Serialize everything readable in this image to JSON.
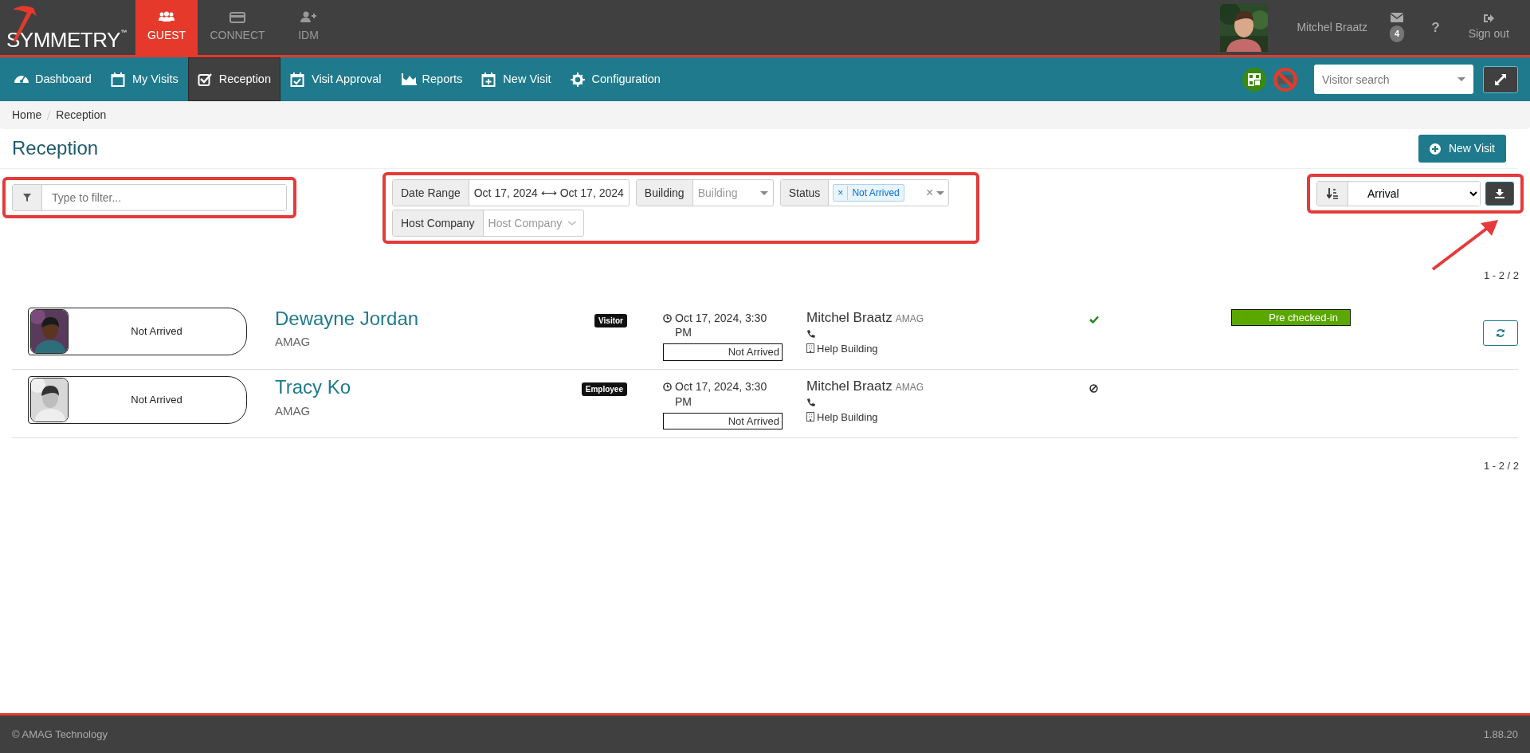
{
  "brand": {
    "name": "SYMMETRY",
    "trademark": "™"
  },
  "apps": [
    {
      "label": "GUEST",
      "selected": true
    },
    {
      "label": "CONNECT",
      "selected": false
    },
    {
      "label": "IDM",
      "selected": false
    }
  ],
  "user": {
    "name": "Mitchel Braatz",
    "message_count": "4",
    "help": "?",
    "sign_out": "Sign out"
  },
  "nav": [
    {
      "label": "Dashboard",
      "selected": false
    },
    {
      "label": "My Visits",
      "selected": false
    },
    {
      "label": "Reception",
      "selected": true
    },
    {
      "label": "Visit Approval",
      "selected": false
    },
    {
      "label": "Reports",
      "selected": false
    },
    {
      "label": "New Visit",
      "selected": false
    },
    {
      "label": "Configuration",
      "selected": false
    }
  ],
  "visitor_search": {
    "placeholder": "Visitor search"
  },
  "breadcrumb": [
    "Home",
    "Reception"
  ],
  "page_title": "Reception",
  "new_visit_button": "New Visit",
  "filter": {
    "placeholder": "Type to filter..."
  },
  "filters": [
    {
      "kind": "text",
      "label": "Date Range",
      "value": "Oct 17, 2024 ⟷ Oct 17, 2024"
    },
    {
      "kind": "select",
      "label": "Building",
      "placeholder": "Building"
    },
    {
      "kind": "tags",
      "label": "Status",
      "tags": [
        "Not Arrived"
      ],
      "tag_remove": "×",
      "clear": "×"
    },
    {
      "kind": "combo",
      "label": "Host Company",
      "placeholder": "Host Company"
    }
  ],
  "sort": {
    "value": "Arrival"
  },
  "pagination_top": "1 - 2 / 2",
  "visits": [
    {
      "status": "Not Arrived",
      "name": "Dewayne Jordan",
      "company": "AMAG",
      "type": "Visitor",
      "time": "Oct 17, 2024, 3:30 PM",
      "arrival_status": "Not Arrived",
      "host": "Mitchel Braatz",
      "host_company": "AMAG",
      "building": "Help Building",
      "approved": true,
      "precheck": "Pre checked-in",
      "refreshable": true
    },
    {
      "status": "Not Arrived",
      "name": "Tracy Ko",
      "company": "AMAG",
      "type": "Employee",
      "time": "Oct 17, 2024, 3:30 PM",
      "arrival_status": "Not Arrived",
      "host": "Mitchel Braatz",
      "host_company": "AMAG",
      "building": "Help Building",
      "approved": false,
      "refreshable": false
    }
  ],
  "pagination_bottom": "1 - 2 / 2",
  "footer": {
    "copyright": "© AMAG Technology",
    "version": "1.88.20"
  }
}
